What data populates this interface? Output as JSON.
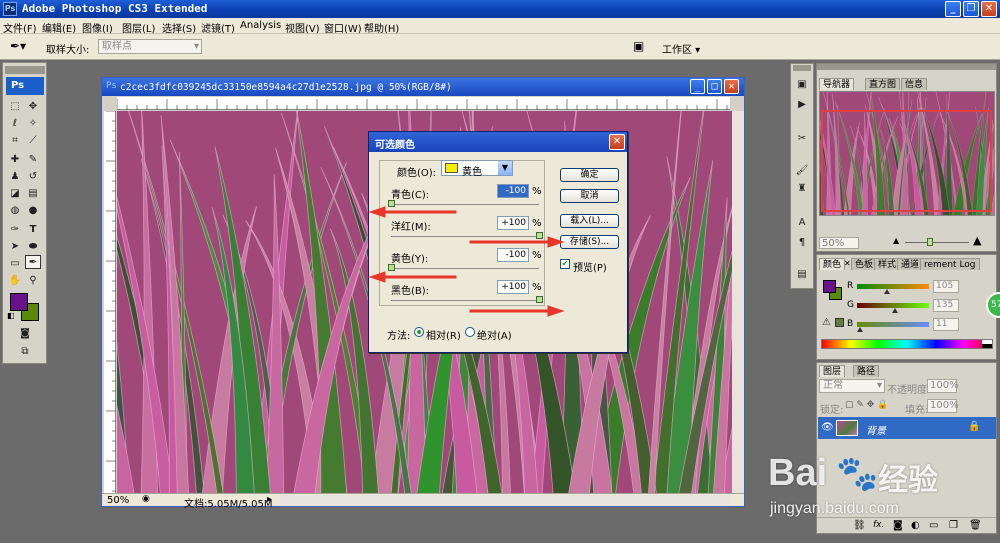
{
  "app": {
    "title": "Adobe Photoshop CS3 Extended",
    "logo": "Ps"
  },
  "menu": [
    "文件(F)",
    "编辑(E)",
    "图像(I)",
    "图层(L)",
    "选择(S)",
    "滤镜(T)",
    "Analysis",
    "视图(V)",
    "窗口(W)",
    "帮助(H)"
  ],
  "options": {
    "sample_size_label": "取样大小:",
    "sample_size_value": "取样点",
    "workspace_label": "工作区 ▾"
  },
  "document": {
    "title": "c2cec3fdfc039245dc33150e8594a4c27d1e2528.jpg @ 50%(RGB/8#)",
    "zoom": "50%",
    "doc_info": "文档:5.05M/5.05M"
  },
  "dialog": {
    "title": "可选颜色",
    "color_label": "颜色(O):",
    "color_value": "黄色",
    "sliders": [
      {
        "label": "青色(C):",
        "value": "-100",
        "pct": 0
      },
      {
        "label": "洋红(M):",
        "value": "+100",
        "pct": 1
      },
      {
        "label": "黄色(Y):",
        "value": "-100",
        "pct": 0
      },
      {
        "label": "黑色(B):",
        "value": "+100",
        "pct": 1
      }
    ],
    "percent": "%",
    "buttons": {
      "ok": "确定",
      "cancel": "取消",
      "load": "载入(L)...",
      "save": "存储(S)..."
    },
    "preview_label": "预览(P)",
    "method_label": "方法:",
    "relative_label": "相对(R)",
    "absolute_label": "绝对(A)"
  },
  "navigator": {
    "tabs": [
      "导航器",
      "直方图",
      "信息"
    ],
    "zoom": "50%"
  },
  "color_panel": {
    "tabs": [
      "颜色",
      "色板",
      "样式",
      "通道",
      "rement Log"
    ],
    "channels": [
      {
        "label": "R",
        "value": "105"
      },
      {
        "label": "G",
        "value": "135"
      },
      {
        "label": "B",
        "value": "11"
      }
    ]
  },
  "layers": {
    "tabs": [
      "图层",
      "路径"
    ],
    "blend_mode": "正常",
    "opacity_label": "不透明度:",
    "opacity_value": "100%",
    "lock_label": "锁定:",
    "fill_label": "填充:",
    "fill_value": "100%",
    "layer_name": "背景"
  },
  "badge": "57",
  "watermark": {
    "brand": "Bai",
    "brand2": "经验",
    "url": "jingyan.baidu.com"
  },
  "colors": {
    "foreground": "#69138b",
    "background": "#5b8a0b",
    "titlebar": "#0a3fb0",
    "accent_red": "#e8362a"
  }
}
